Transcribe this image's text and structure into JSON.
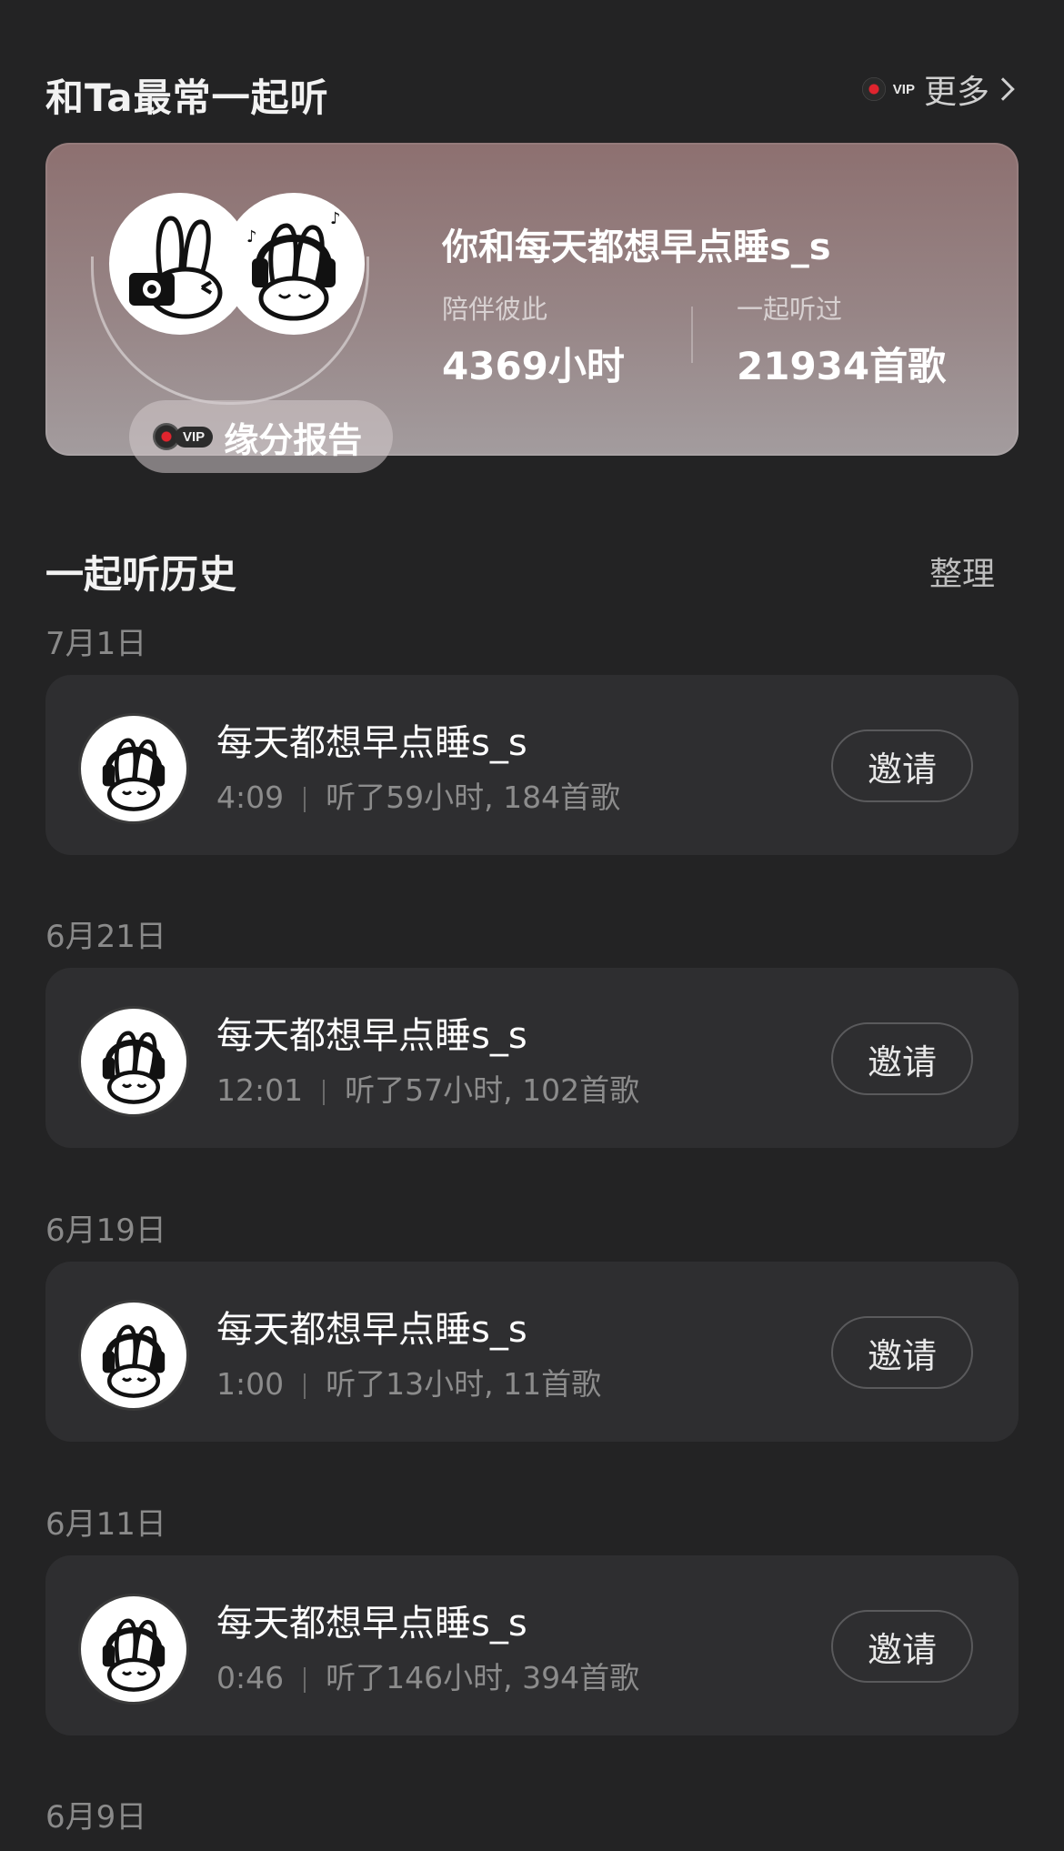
{
  "header": {
    "title": "和Ta最常一起听",
    "vip_label": "VIP",
    "more_label": "更多"
  },
  "banner": {
    "title": "你和每天都想早点睡s_s",
    "report_vip": "VIP",
    "report_label": "缘分报告",
    "stats": [
      {
        "label": "陪伴彼此",
        "value": "4369小时"
      },
      {
        "label": "一起听过",
        "value": "21934首歌"
      }
    ]
  },
  "history": {
    "title": "一起听历史",
    "organize_label": "整理",
    "sections": [
      {
        "date": "7月1日",
        "name": "每天都想早点睡s_s",
        "time": "4:09",
        "summary": "听了59小时, 184首歌",
        "invite": "邀请"
      },
      {
        "date": "6月21日",
        "name": "每天都想早点睡s_s",
        "time": "12:01",
        "summary": "听了57小时, 102首歌",
        "invite": "邀请"
      },
      {
        "date": "6月19日",
        "name": "每天都想早点睡s_s",
        "time": "1:00",
        "summary": "听了13小时, 11首歌",
        "invite": "邀请"
      },
      {
        "date": "6月11日",
        "name": "每天都想早点睡s_s",
        "time": "0:46",
        "summary": "听了146小时, 394首歌",
        "invite": "邀请"
      }
    ],
    "last_date": "6月9日"
  }
}
